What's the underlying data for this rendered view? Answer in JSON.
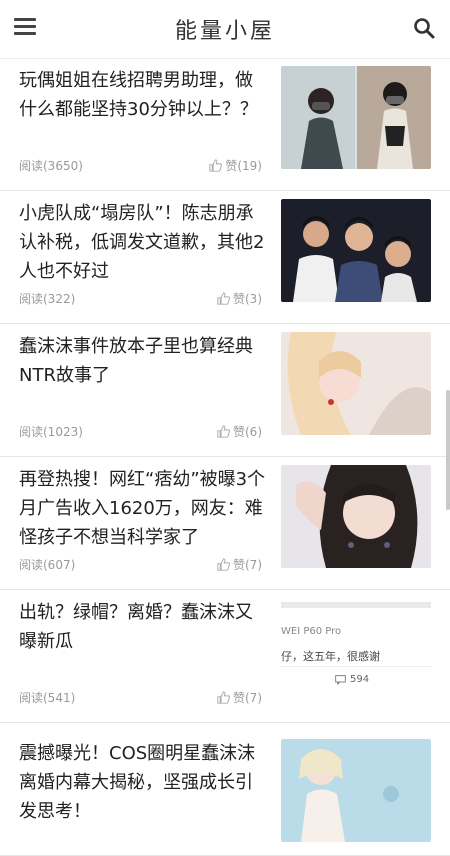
{
  "header": {
    "title": "能量小屋",
    "menu_icon": "menu-icon",
    "search_icon": "search-icon"
  },
  "articles": [
    {
      "title": "玩偶姐姐在线招聘男助理，做什么都能坚持30分钟以上？？",
      "reads": "阅读(3650)",
      "likes": "赞(19)"
    },
    {
      "title": "小虎队成“塌房队”！陈志朋承认补税，低调发文道歉，其他2人也不好过",
      "reads": "阅读(322)",
      "likes": "赞(3)"
    },
    {
      "title": "蠢沫沫事件放本子里也算经典NTR故事了",
      "reads": "阅读(1023)",
      "likes": "赞(6)"
    },
    {
      "title": "再登热搜！网红“痞幼”被曝3个月广告收入1620万，网友：难怪孩子不想当科学家了",
      "reads": "阅读(607)",
      "likes": "赞(7)"
    },
    {
      "title": "出轨？绿帽？离婚？蠢沫沫又曝新瓜",
      "reads": "阅读(541)",
      "likes": "赞(7)",
      "thumb_line1": "WEI P60 Pro",
      "thumb_line2": "仔，这五年，很感谢",
      "thumb_count": "594"
    },
    {
      "title": "震撼曝光！COS圈明星蠢沫沫离婚内幕大揭秘，坚强成长引发思考！",
      "reads": "",
      "likes": ""
    }
  ]
}
